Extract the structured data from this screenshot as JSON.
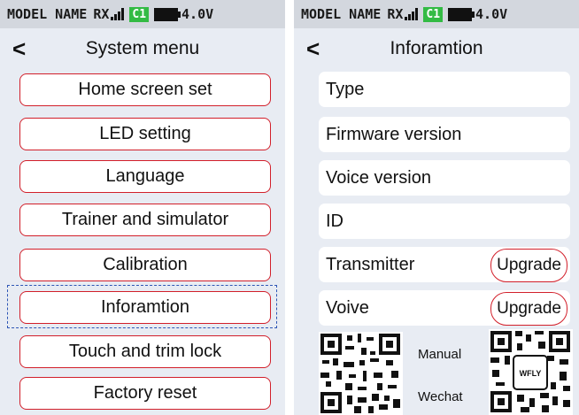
{
  "status": {
    "model": "MODEL NAME",
    "rx": "RX",
    "channel": "C1",
    "voltage": "4.0V"
  },
  "left": {
    "title": "System menu",
    "items": [
      {
        "label": "Home screen set"
      },
      {
        "label": "LED setting"
      },
      {
        "label": "Language"
      },
      {
        "label": "Trainer and simulator"
      },
      {
        "label": "Calibration"
      },
      {
        "label": "Inforamtion"
      },
      {
        "label": "Touch and trim lock"
      },
      {
        "label": "Factory reset"
      }
    ],
    "selected": "Inforamtion"
  },
  "right": {
    "title": "Inforamtion",
    "rows": [
      {
        "label": "Type"
      },
      {
        "label": "Firmware version"
      },
      {
        "label": "Voice version"
      },
      {
        "label": "ID"
      },
      {
        "label": "Transmitter",
        "action": "Upgrade"
      },
      {
        "label": "Voive",
        "action": "Upgrade"
      }
    ],
    "qr": {
      "manual_label": "Manual",
      "wechat_label": "Wechat",
      "logo_text": "WFLY"
    }
  },
  "colors": {
    "accent_red": "#d21f2a",
    "channel_green": "#33bb44",
    "selection_blue": "#2d55b5",
    "screen_bg": "#e8ecf3"
  },
  "icons": [
    "back-arrow-icon",
    "signal-icon",
    "battery-icon",
    "qr-code-icon"
  ]
}
